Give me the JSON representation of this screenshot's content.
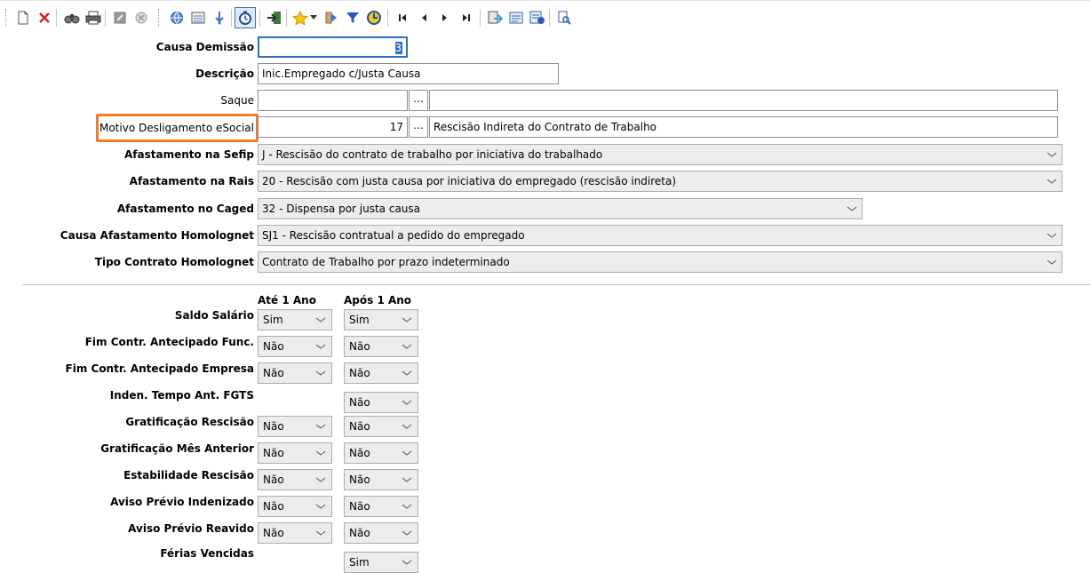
{
  "toolbar": {
    "buttons": [
      {
        "icon": "new-document-icon"
      },
      {
        "icon": "delete-icon"
      },
      {
        "icon": "find-icon"
      },
      {
        "icon": "print-icon"
      },
      {
        "icon": "edit-icon"
      },
      {
        "icon": "cancel-icon"
      },
      {
        "icon": "globe-icon"
      },
      {
        "icon": "list-icon"
      },
      {
        "icon": "info-icon"
      },
      {
        "icon": "timer-icon"
      },
      {
        "icon": "exit-icon"
      },
      {
        "icon": "favorite-star-icon"
      },
      {
        "icon": "dropdown-arrow-icon"
      },
      {
        "icon": "forward-icon"
      },
      {
        "icon": "filter-icon"
      },
      {
        "icon": "refresh-icon"
      },
      {
        "icon": "first-record-icon"
      },
      {
        "icon": "previous-record-icon"
      },
      {
        "icon": "next-record-icon"
      },
      {
        "icon": "last-record-icon"
      },
      {
        "icon": "import-icon"
      },
      {
        "icon": "report-icon"
      },
      {
        "icon": "export-icon"
      },
      {
        "icon": "preview-icon"
      }
    ]
  },
  "form": {
    "causa_demissao": {
      "label": "Causa Demissão",
      "value": "3"
    },
    "descricao": {
      "label": "Descrição",
      "value": "Inic.Empregado c/Justa Causa"
    },
    "saque": {
      "label": "Saque",
      "code": "",
      "description": ""
    },
    "motivo_esocial": {
      "label": "Motivo Desligamento eSocial",
      "code": "17",
      "description": "Rescisão Indireta do Contrato de Trabalho"
    },
    "afastamento_sefip": {
      "label": "Afastamento na Sefip",
      "value": "J - Rescisão do contrato de trabalho por iniciativa do trabalhado"
    },
    "afastamento_rais": {
      "label": "Afastamento na Rais",
      "value": "20 - Rescisão com justa causa por iniciativa do empregado (rescisão indireta)"
    },
    "afastamento_caged": {
      "label": "Afastamento no Caged",
      "value": "32 - Dispensa por justa causa"
    },
    "causa_homolognet": {
      "label": "Causa Afastamento Homolognet",
      "value": "SJ1 - Rescisão contratual a pedido do empregado"
    },
    "tipo_contrato": {
      "label": "Tipo Contrato Homolognet",
      "value": "Contrato de Trabalho por prazo indeterminado"
    }
  },
  "grid": {
    "col_ate_1_ano": "Até 1 Ano",
    "col_apos_1_ano": "Após 1 Ano",
    "rows": [
      {
        "label": "Saldo Salário",
        "ate": "Sim",
        "apos": "Sim"
      },
      {
        "label": "Fim Contr. Antecipado Func.",
        "ate": "Não",
        "apos": "Não"
      },
      {
        "label": "Fim Contr. Antecipado Empresa",
        "ate": "Não",
        "apos": "Não"
      },
      {
        "label": "Inden. Tempo Ant. FGTS",
        "ate": null,
        "apos": "Não"
      },
      {
        "label": "Gratificação Rescisão",
        "ate": "Não",
        "apos": "Não"
      },
      {
        "label": "Gratificação Mês Anterior",
        "ate": "Não",
        "apos": "Não"
      },
      {
        "label": "Estabilidade Rescisão",
        "ate": "Não",
        "apos": "Não"
      },
      {
        "label": "Aviso Prévio Indenizado",
        "ate": "Não",
        "apos": "Não"
      },
      {
        "label": "Aviso Prévio Reavido",
        "ate": "Não",
        "apos": "Não"
      },
      {
        "label": "Férias Vencidas",
        "ate": null,
        "apos": "Sim"
      }
    ]
  },
  "colors": {
    "highlight": "#f07a2d",
    "cursor": "#2f6fc6"
  }
}
